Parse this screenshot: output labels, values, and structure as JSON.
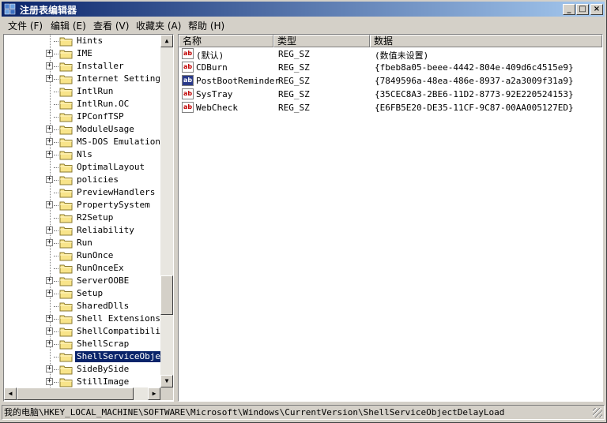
{
  "window": {
    "title": "注册表编辑器"
  },
  "titlebar_buttons": {
    "minimize": "_",
    "maximize": "□",
    "close": "×"
  },
  "menu": [
    {
      "label": "文件 (F)"
    },
    {
      "label": "编辑 (E)"
    },
    {
      "label": "查看 (V)"
    },
    {
      "label": "收藏夹 (A)"
    },
    {
      "label": "帮助 (H)"
    }
  ],
  "tree": {
    "items": [
      {
        "label": "Hints",
        "expandable": false,
        "selected": false
      },
      {
        "label": "IME",
        "expandable": true,
        "selected": false
      },
      {
        "label": "Installer",
        "expandable": true,
        "selected": false
      },
      {
        "label": "Internet Settings",
        "expandable": true,
        "selected": false
      },
      {
        "label": "IntlRun",
        "expandable": false,
        "selected": false
      },
      {
        "label": "IntlRun.OC",
        "expandable": false,
        "selected": false
      },
      {
        "label": "IPConfTSP",
        "expandable": false,
        "selected": false
      },
      {
        "label": "ModuleUsage",
        "expandable": true,
        "selected": false
      },
      {
        "label": "MS-DOS Emulation",
        "expandable": true,
        "selected": false
      },
      {
        "label": "Nls",
        "expandable": true,
        "selected": false
      },
      {
        "label": "OptimalLayout",
        "expandable": false,
        "selected": false
      },
      {
        "label": "policies",
        "expandable": true,
        "selected": false
      },
      {
        "label": "PreviewHandlers",
        "expandable": false,
        "selected": false
      },
      {
        "label": "PropertySystem",
        "expandable": true,
        "selected": false
      },
      {
        "label": "R2Setup",
        "expandable": false,
        "selected": false
      },
      {
        "label": "Reliability",
        "expandable": true,
        "selected": false
      },
      {
        "label": "Run",
        "expandable": true,
        "selected": false
      },
      {
        "label": "RunOnce",
        "expandable": false,
        "selected": false
      },
      {
        "label": "RunOnceEx",
        "expandable": false,
        "selected": false
      },
      {
        "label": "ServerOOBE",
        "expandable": true,
        "selected": false
      },
      {
        "label": "Setup",
        "expandable": true,
        "selected": false
      },
      {
        "label": "SharedDlls",
        "expandable": false,
        "selected": false
      },
      {
        "label": "Shell Extensions",
        "expandable": true,
        "selected": false
      },
      {
        "label": "ShellCompatibility",
        "expandable": true,
        "selected": false
      },
      {
        "label": "ShellScrap",
        "expandable": true,
        "selected": false
      },
      {
        "label": "ShellServiceObject",
        "expandable": false,
        "selected": true
      },
      {
        "label": "SideBySide",
        "expandable": true,
        "selected": false
      },
      {
        "label": "StillImage",
        "expandable": true,
        "selected": false
      }
    ]
  },
  "list": {
    "headers": {
      "name": "名称",
      "type": "类型",
      "data": "数据"
    },
    "rows": [
      {
        "icon": "ab",
        "name": "(默认)",
        "type": "REG_SZ",
        "data": "(数值未设置)"
      },
      {
        "icon": "ab",
        "name": "CDBurn",
        "type": "REG_SZ",
        "data": "{fbeb8a05-beee-4442-804e-409d6c4515e9}"
      },
      {
        "icon": "ab",
        "name": "PostBootReminder",
        "type": "REG_SZ",
        "data": "{7849596a-48ea-486e-8937-a2a3009f31a9}"
      },
      {
        "icon": "ab",
        "name": "SysTray",
        "type": "REG_SZ",
        "data": "{35CEC8A3-2BE6-11D2-8773-92E220524153}"
      },
      {
        "icon": "ab",
        "name": "WebCheck",
        "type": "REG_SZ",
        "data": "{E6FB5E20-DE35-11CF-9C87-00AA005127ED}"
      }
    ]
  },
  "status": {
    "path": "我的电脑\\HKEY_LOCAL_MACHINE\\SOFTWARE\\Microsoft\\Windows\\CurrentVersion\\ShellServiceObjectDelayLoad"
  },
  "colors": {
    "titlebar_start": "#0a246a",
    "titlebar_end": "#a6caf0",
    "selection": "#0a246a",
    "face": "#d4d0c8"
  }
}
